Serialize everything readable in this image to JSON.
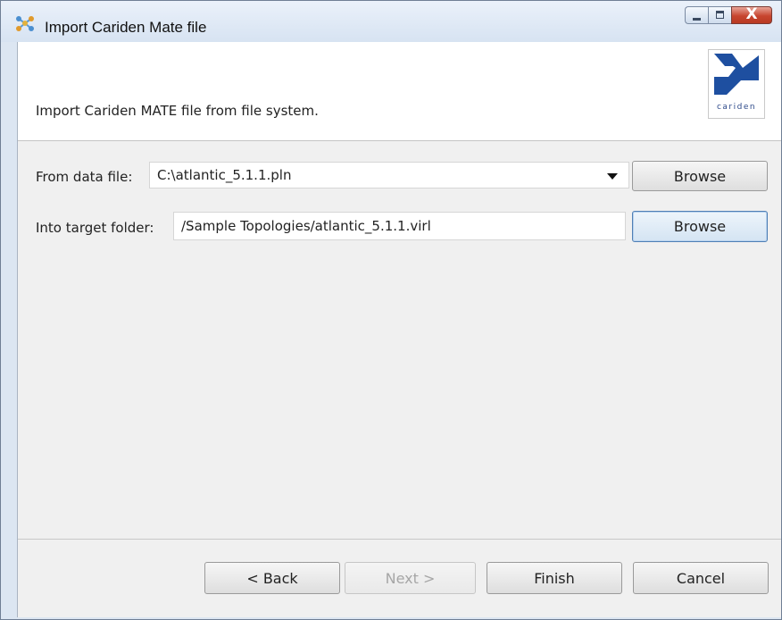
{
  "window": {
    "title": "Import Cariden Mate file",
    "icon": "network-nodes-icon",
    "caption": {
      "minimize_icon": "minimize-icon",
      "maximize_icon": "maximize-icon",
      "close_glyph": "X"
    }
  },
  "header": {
    "description": "Import Cariden MATE file from file system.",
    "logo_text": "cariden",
    "logo_color": "#1e4fa0"
  },
  "form": {
    "from_label": "From data file:",
    "from_value": "C:\\atlantic_5.1.1.pln",
    "from_browse": "Browse",
    "target_label": "Into target folder:",
    "target_value": "/Sample Topologies/atlantic_5.1.1.virl",
    "target_browse": "Browse"
  },
  "footer": {
    "back": "< Back",
    "next": "Next >",
    "finish": "Finish",
    "cancel": "Cancel"
  }
}
